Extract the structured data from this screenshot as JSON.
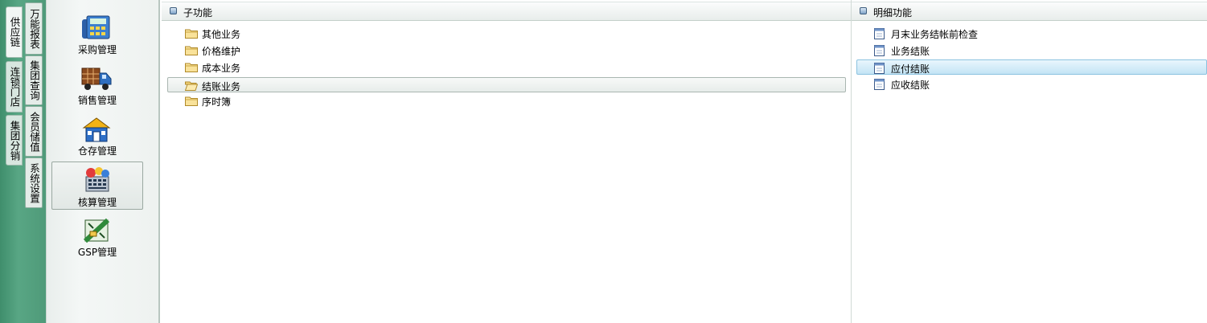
{
  "outer_tabs": [
    {
      "label": "供应链",
      "active": true
    },
    {
      "label": "连锁门店",
      "active": false
    },
    {
      "label": "集团分销",
      "active": false
    }
  ],
  "inner_tabs": [
    {
      "label": "万能报表"
    },
    {
      "label": "集团查询"
    },
    {
      "label": "会员储值"
    },
    {
      "label": "系统设置"
    }
  ],
  "modules": [
    {
      "label": "采购管理",
      "icon": "purchase-icon"
    },
    {
      "label": "销售管理",
      "icon": "sales-truck-icon"
    },
    {
      "label": "仓存管理",
      "icon": "warehouse-icon"
    },
    {
      "label": "核算管理",
      "icon": "accounting-icon",
      "active": true
    },
    {
      "label": "GSP管理",
      "icon": "gsp-icon"
    }
  ],
  "sub_pane": {
    "title": "子功能",
    "items": [
      {
        "label": "其他业务"
      },
      {
        "label": "价格维护"
      },
      {
        "label": "成本业务"
      },
      {
        "label": "结账业务",
        "selected": true
      },
      {
        "label": "序时簿"
      }
    ]
  },
  "detail_pane": {
    "title": "明细功能",
    "items": [
      {
        "label": "月末业务结帐前检查"
      },
      {
        "label": "业务结账"
      },
      {
        "label": "应付结账",
        "selected": true
      },
      {
        "label": "应收结账"
      }
    ]
  },
  "colors": {
    "green_strip": "#4f9a79",
    "detail_selection": "#c3e4f5"
  }
}
